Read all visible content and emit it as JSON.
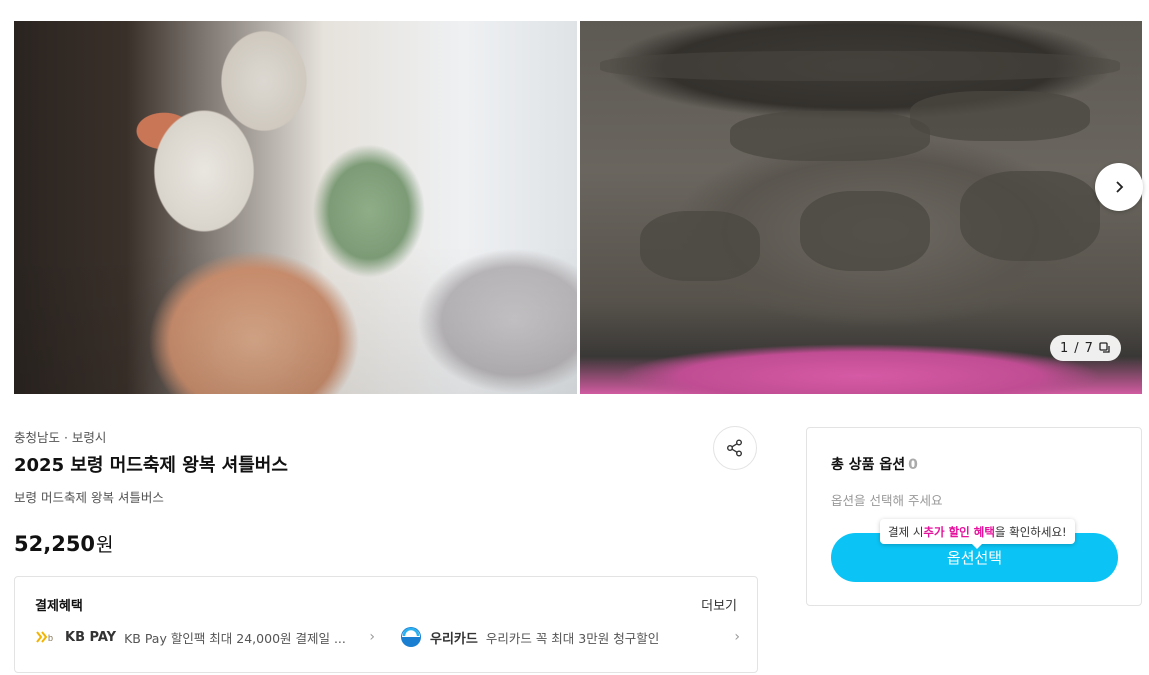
{
  "gallery": {
    "counter_current": "1",
    "counter_sep": "/",
    "counter_total": "7",
    "next_icon": "chevron-right-icon",
    "copy_icon": "gallery-icon"
  },
  "product": {
    "region": "충청남도 · 보령시",
    "title": "2025 보령 머드축제 왕복 셔틀버스",
    "subtitle": "보령 머드축제 왕복 셔틀버스",
    "price": "52,250",
    "currency": "원"
  },
  "benefits": {
    "title": "결제혜택",
    "more_label": "더보기",
    "items": [
      {
        "brand": "KB PAY",
        "description": "KB Pay 할인팩 최대 24,000원 결제일 ..."
      },
      {
        "brand": "우리카드",
        "description": "우리카드 꼭 최대 3만원 청구할인"
      }
    ]
  },
  "options": {
    "title": "총 상품 옵션",
    "count": "0",
    "hint": "옵션을 선택해 주세요",
    "tooltip_prefix": "결제 시 ",
    "tooltip_highlight": "추가 할인 혜택",
    "tooltip_suffix": "을 확인하세요!",
    "button_label": "옵션선택"
  },
  "colors": {
    "accent": "#0bc4f5",
    "highlight": "#e6119d"
  }
}
